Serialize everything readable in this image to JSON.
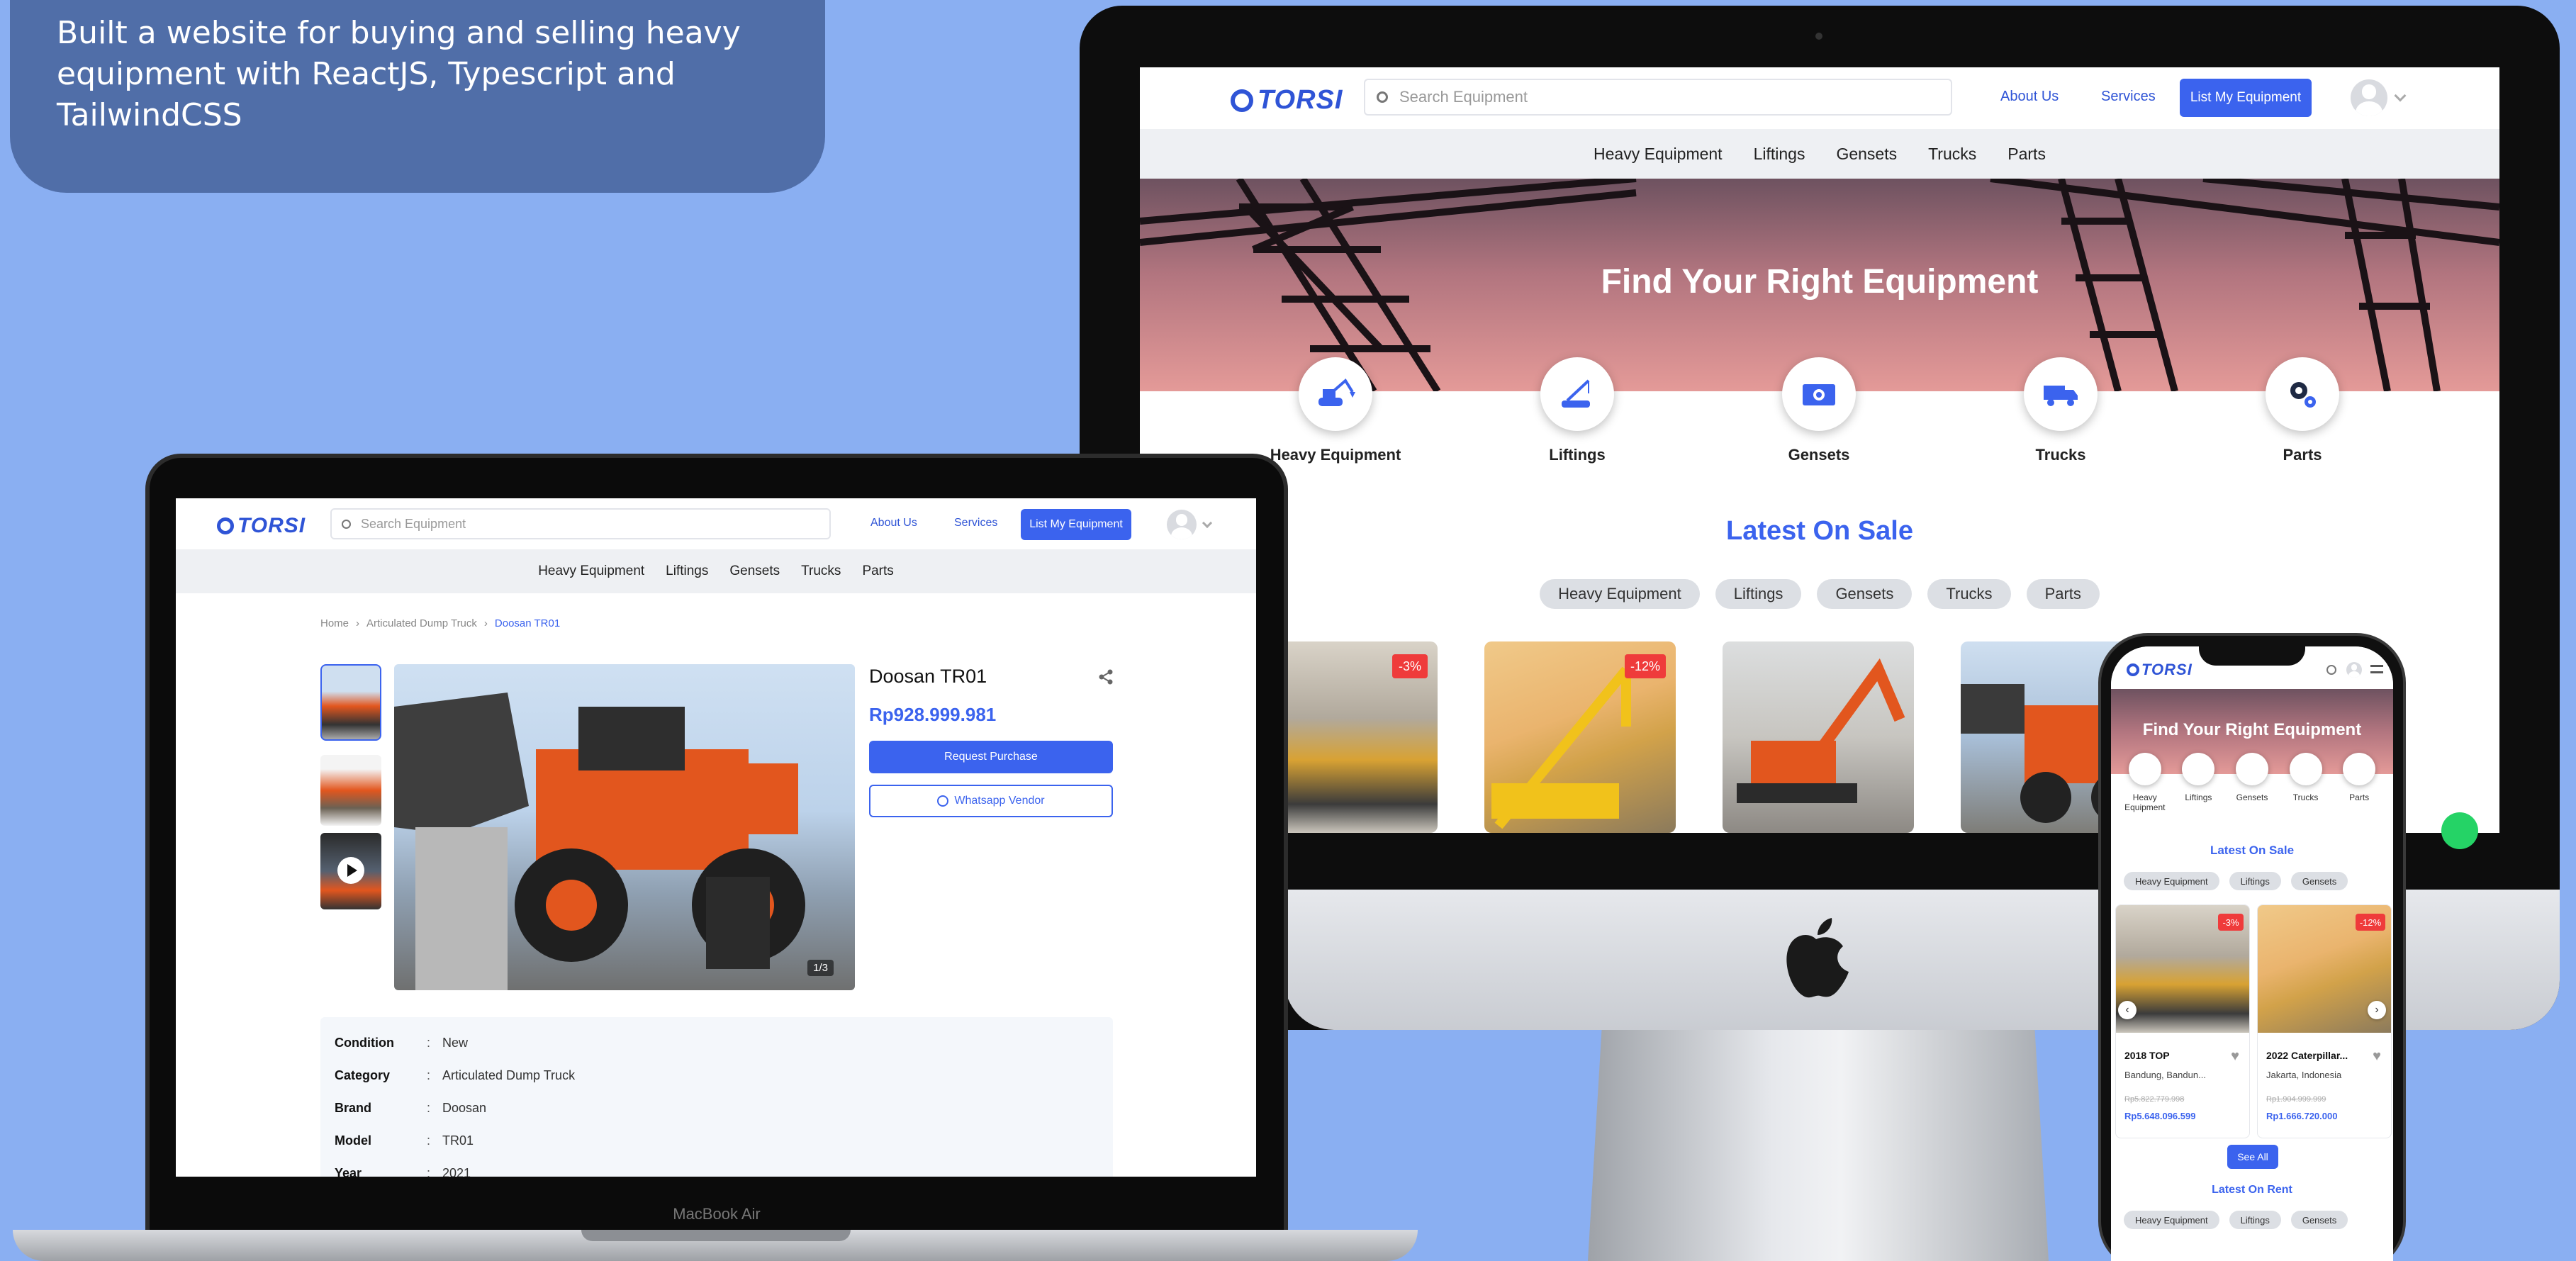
{
  "caption": {
    "line1": "Built a website for buying and selling heavy",
    "line2": "equipment with ReactJS, Typescript and",
    "line3": "TailwindCSS"
  },
  "site": {
    "logo": "TORSI",
    "search_placeholder": "Search Equipment",
    "about_label": "About Us",
    "services_label": "Services",
    "list_label": "List My Equipment",
    "categories": [
      "Heavy Equipment",
      "Liftings",
      "Gensets",
      "Trucks",
      "Parts"
    ]
  },
  "home": {
    "hero_title": "Find Your Right Equipment",
    "latest_title": "Latest On Sale",
    "latest_rent_title": "Latest On Rent",
    "filter_pills": [
      "Heavy Equipment",
      "Liftings",
      "Gensets",
      "Trucks",
      "Parts"
    ],
    "badges": [
      "-3%",
      "-12%"
    ],
    "see_all": "See All",
    "phone_cards": [
      {
        "title": "2018 TOP",
        "location": "Bandung, Bandun...",
        "old_price": "Rp5.822.779.998",
        "price": "Rp5.648.096.599",
        "badge": "-3%"
      },
      {
        "title": "2022 Caterpillar...",
        "location": "Jakarta, Indonesia",
        "old_price": "Rp1.904.999.999",
        "price": "Rp1.666.720.000",
        "badge": "-12%"
      }
    ],
    "phone_categories": [
      "Heavy Equipment",
      "Liftings",
      "Gensets",
      "Trucks",
      "Parts"
    ]
  },
  "product": {
    "breadcrumb": [
      "Home",
      "Articulated Dump Truck",
      "Doosan TR01"
    ],
    "name": "Doosan TR01",
    "price": "Rp928.999.981",
    "request_label": "Request Purchase",
    "whatsapp_label": "Whatsapp Vendor",
    "image_counter": "1/3",
    "specs": [
      {
        "label": "Condition",
        "value": "New"
      },
      {
        "label": "Category",
        "value": "Articulated Dump Truck"
      },
      {
        "label": "Brand",
        "value": "Doosan"
      },
      {
        "label": "Model",
        "value": "TR01"
      },
      {
        "label": "Year",
        "value": "2021"
      }
    ]
  },
  "devices": {
    "macbook_label": "MacBook Air"
  },
  "colors": {
    "background": "#8aaff2",
    "brand_blue": "#3b63ee",
    "badge_red": "#ef3b3b",
    "machine_orange": "#e2561e"
  }
}
